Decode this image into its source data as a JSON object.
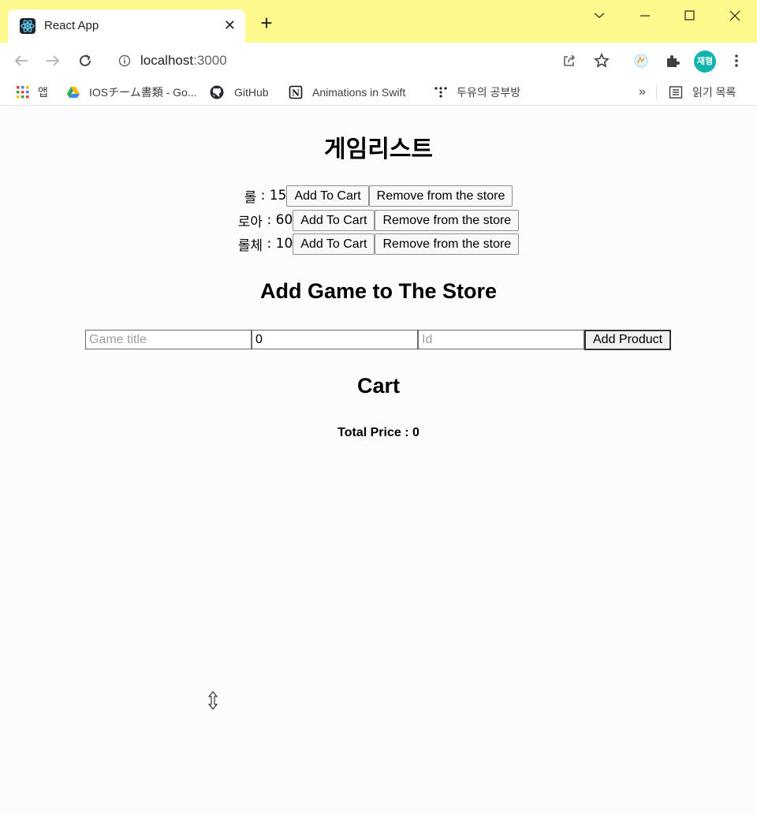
{
  "browser": {
    "tab_title": "React App",
    "url_host": "localhost",
    "url_port": ":3000",
    "profile_initials": "재형",
    "tab_close_glyph": "✕",
    "new_tab_glyph": "+",
    "bookmarks": [
      {
        "label": "앱",
        "icon": "apps-grid-icon"
      },
      {
        "label": "IOSチーム書類 - Go...",
        "icon": "google-drive-icon"
      },
      {
        "label": "GitHub",
        "icon": "github-icon"
      },
      {
        "label": "Animations in Swift",
        "icon": "notion-icon"
      },
      {
        "label": "두유의 공부방",
        "icon": "dots-logo-icon"
      }
    ],
    "bookmarks_overflow": "»",
    "reading_list": "읽기 목록"
  },
  "page": {
    "title": "게임리스트",
    "games": [
      {
        "name": "롤",
        "price": "15"
      },
      {
        "name": "로아",
        "price": "60"
      },
      {
        "name": "롤체",
        "price": "10"
      }
    ],
    "separator": " : ",
    "add_to_cart_label": "Add To Cart",
    "remove_label": "Remove from the store",
    "add_game_heading": "Add Game to The Store",
    "form": {
      "title_placeholder": "Game title",
      "price_value": "0",
      "id_placeholder": "Id",
      "submit_label": "Add Product"
    },
    "cart_heading": "Cart",
    "total_label": "Total Price : 0"
  }
}
